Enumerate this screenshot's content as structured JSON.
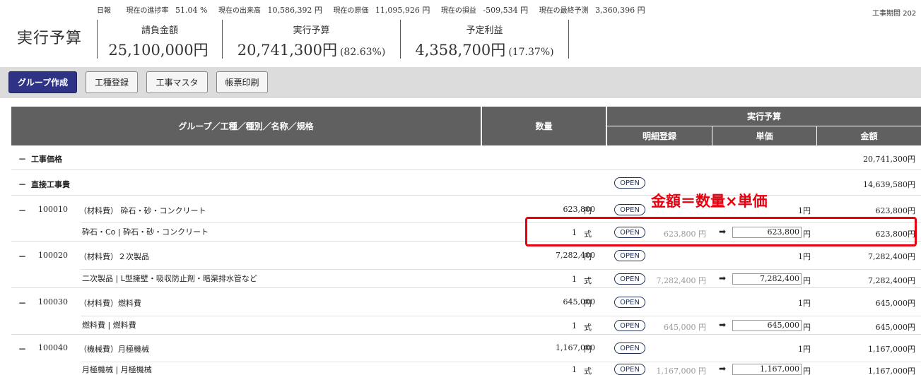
{
  "header": {
    "stats": [
      {
        "label": "日報",
        "value": ""
      },
      {
        "label": "現在の進捗率",
        "value": "51.04 %"
      },
      {
        "label": "現在の出来高",
        "value": "10,586,392 円"
      },
      {
        "label": "現在の原価",
        "value": "11,095,926 円"
      },
      {
        "label": "現在の損益",
        "value": "-509,534 円"
      },
      {
        "label": "現在の最終予測",
        "value": "3,360,396 円"
      }
    ],
    "period_label": "工事期間",
    "period_value": "202",
    "page_title": "実行予算",
    "summary": [
      {
        "label": "請負金額",
        "value": "25,100,000円",
        "pct": ""
      },
      {
        "label": "実行予算",
        "value": "20,741,300円",
        "pct": "(82.63%)"
      },
      {
        "label": "予定利益",
        "value": "4,358,700円",
        "pct": "(17.37%)"
      }
    ]
  },
  "toolbar": {
    "group_create": "グループ作成",
    "work_type_register": "工種登録",
    "work_master": "工事マスタ",
    "form_print": "帳票印刷"
  },
  "table": {
    "headers": {
      "name": "グループ／工種／種別／名称／規格",
      "qty": "数量",
      "budget": "実行予算",
      "detail": "明細登録",
      "unit_price": "単価",
      "amount": "金額"
    },
    "open_label": "OPEN",
    "collapse_symbol": "－",
    "arrow_symbol": "➡",
    "rows": {
      "r0": {
        "name": "工事価格",
        "amount": "20,741,300円"
      },
      "r1": {
        "name": "直接工事費",
        "amount": "14,639,580円"
      },
      "r2": {
        "code": "100010",
        "name": "（材料費） 砕石・砂・コンクリート",
        "qty": "623,800",
        "unit": "円",
        "unit_price": "1円",
        "amount": "623,800円"
      },
      "r3": {
        "name": "砕石・Co | 砕石・砂・コンクリート",
        "qty": "1",
        "unit": "式",
        "ref": "623,800 円",
        "input": "623,800",
        "yen": "円",
        "amount": "623,800円"
      },
      "r4": {
        "code": "100020",
        "name": "（材料費）２次製品",
        "qty": "7,282,400",
        "unit": "円",
        "unit_price": "1円",
        "amount": "7,282,400円"
      },
      "r5": {
        "name": "二次製品 | L型擁壁・吸収防止剤・暗渠排水管など",
        "qty": "1",
        "unit": "式",
        "ref": "7,282,400 円",
        "input": "7,282,400",
        "yen": "円",
        "amount": "7,282,400円"
      },
      "r6": {
        "code": "100030",
        "name": "（材料費）燃料費",
        "qty": "645,000",
        "unit": "円",
        "unit_price": "1円",
        "amount": "645,000円"
      },
      "r7": {
        "name": "燃料費 | 燃料費",
        "qty": "1",
        "unit": "式",
        "ref": "645,000 円",
        "input": "645,000",
        "yen": "円",
        "amount": "645,000円"
      },
      "r8": {
        "code": "100040",
        "name": "（機械費）月極機械",
        "qty": "1,167,000",
        "unit": "円",
        "unit_price": "1円",
        "amount": "1,167,000円"
      },
      "r9": {
        "name": "月極機械 | 月極機械",
        "qty": "1",
        "unit": "式",
        "ref": "1,167,000 円",
        "input": "1,167,000",
        "yen": "円",
        "amount": "1,167,000円"
      }
    }
  },
  "annotation": {
    "text": "金額＝数量×単価",
    "color": "#e8000f"
  },
  "colors": {
    "primary_button": "#2e3385",
    "table_header": "#606060",
    "toolbar_bg": "#dcdcdc"
  }
}
